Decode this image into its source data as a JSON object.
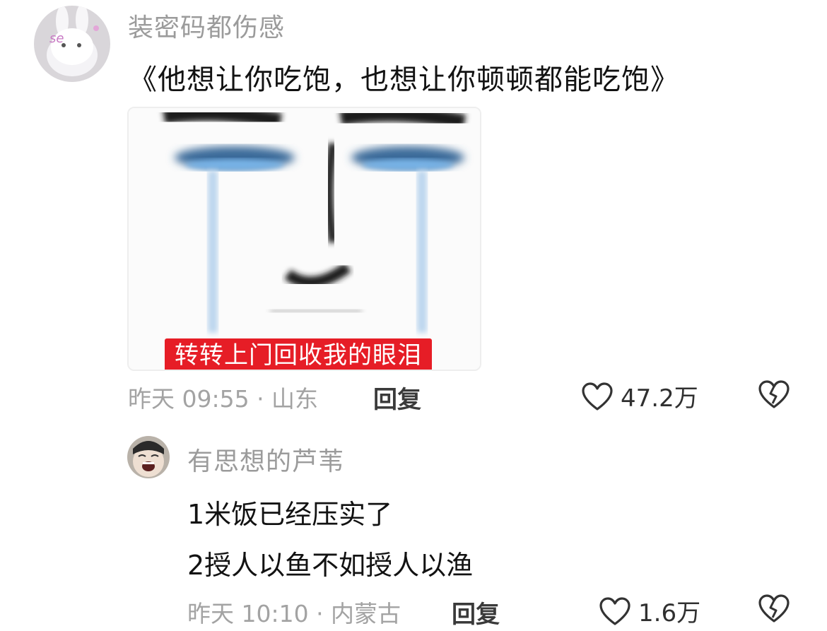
{
  "comment": {
    "username": "装密码都伤感",
    "text": "《他想让你吃饱，也想让你顿顿都能吃饱》",
    "image_caption": "转转上门回收我的眼泪",
    "meta": "昨天 09:55 · 山东",
    "reply_label": "回复",
    "likes": "47.2万"
  },
  "reply": {
    "username": "有思想的芦苇",
    "lines": [
      "1米饭已经压实了",
      "2授人以鱼不如授人以渔"
    ],
    "meta": "昨天 10:10 · 内蒙古",
    "reply_label": "回复",
    "likes": "1.6万"
  },
  "colors": {
    "username": "#9b9b9b",
    "meta": "#a3a3a3",
    "caption_bg": "#e61d26",
    "caption_text": "#ffffff"
  },
  "icons": {
    "like": "heart-outline-icon",
    "dislike": "broken-heart-icon"
  }
}
